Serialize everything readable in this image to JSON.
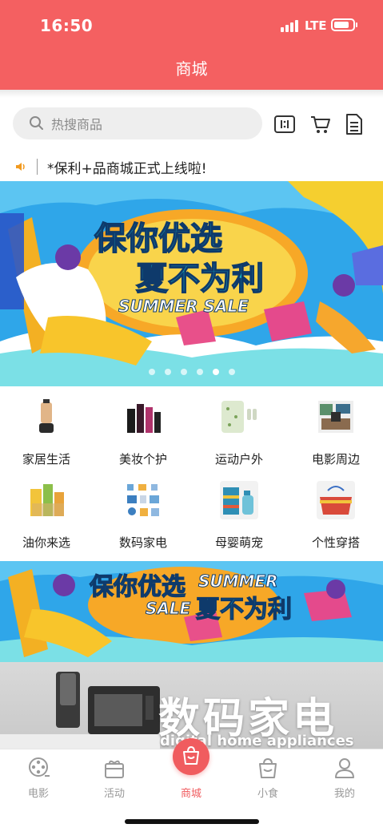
{
  "status_bar": {
    "time": "16:50",
    "network": "LTE"
  },
  "header": {
    "title": "商城"
  },
  "search": {
    "placeholder": "热搜商品"
  },
  "toolbar": {
    "scan_icon": "scan-icon",
    "cart_icon": "cart-icon",
    "orders_icon": "document-icon"
  },
  "notice": {
    "text": "*保利+品商城正式上线啦!"
  },
  "banner1": {
    "line1": "保你优选",
    "line2": "夏不为利",
    "line3": "SUMMER SALE"
  },
  "categories": [
    {
      "label": "家居生活",
      "icon": "juicer"
    },
    {
      "label": "美妆个护",
      "icon": "cosmetics"
    },
    {
      "label": "运动户外",
      "icon": "pillow"
    },
    {
      "label": "电影周边",
      "icon": "movie-merch"
    },
    {
      "label": "油你来选",
      "icon": "oil"
    },
    {
      "label": "数码家电",
      "icon": "digital"
    },
    {
      "label": "母婴萌宠",
      "icon": "baby-towel"
    },
    {
      "label": "个性穿搭",
      "icon": "bag"
    }
  ],
  "banner2": {
    "line1": "保你优选",
    "line2": "SUMMER",
    "line3": "SALE",
    "line4": "夏不为利"
  },
  "digital_section": {
    "title": "数码家电",
    "subtitle": "digital home appliances"
  },
  "tabbar": {
    "tabs": [
      {
        "label": "电影"
      },
      {
        "label": "活动"
      },
      {
        "label": "商城"
      },
      {
        "label": "小食"
      },
      {
        "label": "我的"
      }
    ],
    "active": "商城"
  },
  "colors": {
    "brand": "#f46061",
    "active_tab": "#f05c5f"
  }
}
